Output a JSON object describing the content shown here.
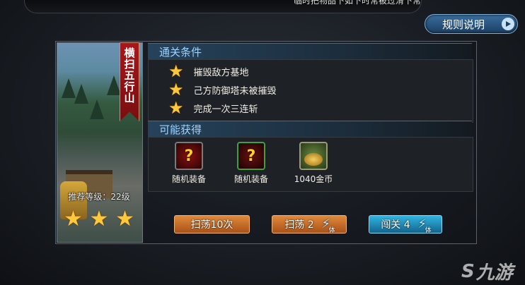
{
  "top_banner": {
    "text": "临时把物品下如下时常被过滑下常留。"
  },
  "rules_button": {
    "label": "规则说明",
    "icon": "play-icon"
  },
  "stage": {
    "name": "横扫五行山",
    "recommended_level": "推荐等级：22级",
    "stars_earned": 3,
    "stars": [
      "★",
      "★",
      "★"
    ]
  },
  "conditions": {
    "header": "通关条件",
    "items": [
      {
        "text": "摧毁敌方基地",
        "star": "★"
      },
      {
        "text": "己方防御塔未被摧毁",
        "star": "★"
      },
      {
        "text": "完成一次三连斩",
        "star": "★"
      }
    ]
  },
  "rewards": {
    "header": "可能获得",
    "items": [
      {
        "label": "随机装备",
        "icon": "random-equipment-icon",
        "glyph": "?"
      },
      {
        "label": "随机装备",
        "icon": "random-equipment-icon",
        "glyph": "?"
      },
      {
        "label": "1040金币",
        "icon": "gold-coins-icon",
        "glyph": ""
      }
    ]
  },
  "buttons": {
    "sweep10": {
      "label": "扫荡10次"
    },
    "sweep": {
      "label": "扫荡 2",
      "stamina_glyph": "⚡",
      "stamina_text": "体"
    },
    "challenge": {
      "label": "闯关 4",
      "stamina_glyph": "⚡",
      "stamina_text": "体"
    }
  },
  "watermark": {
    "text": "九游",
    "glyph": "S"
  },
  "colors": {
    "star": "#ffc83a",
    "stage_banner": "#a8161a",
    "section_header_text": "#9ed4ff",
    "orange_button": "#e0893a",
    "blue_button": "#31b5e0"
  }
}
